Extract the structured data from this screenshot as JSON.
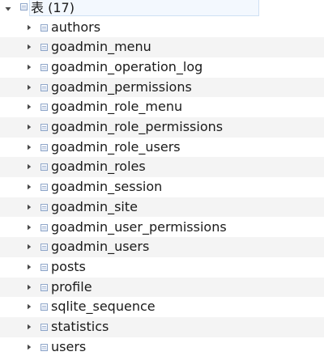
{
  "tree": {
    "root": {
      "label": "表 (17)",
      "icon": "table-folder-icon",
      "expanded": true
    },
    "tables": [
      {
        "name": "authors"
      },
      {
        "name": "goadmin_menu"
      },
      {
        "name": "goadmin_operation_log"
      },
      {
        "name": "goadmin_permissions"
      },
      {
        "name": "goadmin_role_menu"
      },
      {
        "name": "goadmin_role_permissions"
      },
      {
        "name": "goadmin_role_users"
      },
      {
        "name": "goadmin_roles"
      },
      {
        "name": "goadmin_session"
      },
      {
        "name": "goadmin_site"
      },
      {
        "name": "goadmin_user_permissions"
      },
      {
        "name": "goadmin_users"
      },
      {
        "name": "posts"
      },
      {
        "name": "profile"
      },
      {
        "name": "sqlite_sequence"
      },
      {
        "name": "statistics"
      },
      {
        "name": "users"
      }
    ],
    "colors": {
      "alt_row": "#f4f4f4",
      "text": "#1a1a1a",
      "icon_border": "#8fa6c9",
      "selection_border": "#cfe0f3"
    }
  }
}
